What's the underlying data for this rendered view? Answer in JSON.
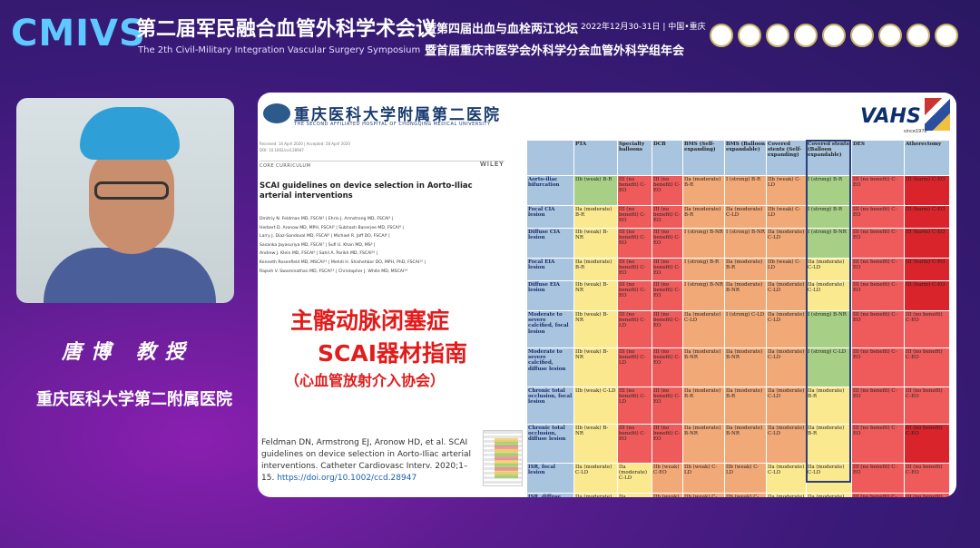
{
  "header": {
    "logo": "CMIVS",
    "title": "第二届军民融合血管外科学术会议",
    "subtitle": "The 2th Civil-Military Integration Vascular Surgery Symposium",
    "forum1": "暨第四届出血与血栓两江论坛",
    "date": "2022年12月30-31日 | 中国•重庆",
    "forum2": "暨首届重庆市医学会外科学分会血管外科学组年会"
  },
  "speaker": {
    "name": "唐博 教授",
    "affiliation": "重庆医科大学第二附属医院"
  },
  "slide": {
    "hospital_name": "重庆医科大学附属第二医院",
    "hospital_en": "THE SECOND AFFILIATED HOSPITAL OF CHONGQING MEDICAL UNIVERSITY",
    "vahs": "VAHS",
    "vahs_sub": "since1978",
    "paper": {
      "received": "Received: 14 April 2020 | Accepted: 28 April 2020",
      "doi_small": "DOI: 10.1002/ccd.28947",
      "curriculum": "CORE CURRICULUM",
      "publisher": "WILEY",
      "title": "SCAI guidelines on device selection in Aorto-Iliac arterial interventions",
      "authors": [
        "Dmitriy N. Feldman MD, FSCAI¹ | Ehrin J. Armstrong MD, FSCAI² |",
        "Herbert D. Aronow MD, MPH, FSCAI³ | Subhash Banerjee MD, FSCAI⁴ |",
        "Larry J. Diaz-Sandoval MD, FSCAI⁵ | Michael R. Jaff DO, FSCAI⁶ |",
        "Sasanka Jayasuriya MD, FSCAI⁷ | Sufi U. Khan MD, MS⁸ |",
        "Andrew J. Klein MD, FSCAI⁹ | Sahil A. Parikh MD, FSCAI¹⁰ |",
        "Kenneth Rosenfield MD, MSCAI¹¹ | Mehdi H. Shishehbor DO, MPH, PhD, FSCAI¹² |",
        "Rajesh V. Swaminathan MD, FSCAI¹³ | Christopher J. White MD, MSCAI¹⁴"
      ]
    },
    "cn_title_line1": "主髂动脉闭塞症",
    "cn_title_line2": "SCAI器材指南",
    "cn_title_line3": "（心血管放射介入协会）",
    "citation": "Feldman DN, Armstrong EJ, Aronow HD, et al. SCAI guidelines on device selection in Aorto-Iliac arterial interventions. Catheter Cardiovasc Interv. 2020;1–15.",
    "citation_doi": "https://doi.org/10.1002/ccd.28947",
    "table": {
      "headers": [
        "",
        "PTA",
        "Specialty balloons",
        "DCB",
        "BMS (Self-expanding)",
        "BMS (Balloon expandable)",
        "Covered stents (Self-expanding)",
        "Covered stents (Balloon expandable)",
        "DES",
        "Atherectomy"
      ],
      "rows": [
        {
          "label": "Aorto-iliac bifurcation",
          "h": "h2",
          "cells": [
            [
              "IIb (weak) B-R",
              "g"
            ],
            [
              "III (no benefit) C-EO",
              "r"
            ],
            [
              "III (no benefit) C-EO",
              "r"
            ],
            [
              "IIa (moderate) B-R",
              "o"
            ],
            [
              "I (strong) B-R",
              "o"
            ],
            [
              "IIb (weak) C-LD",
              "o"
            ],
            [
              "I (strong) B-R",
              "g"
            ],
            [
              "III (no benefit) C-EO",
              "r"
            ],
            [
              "III (harm) C-EO",
              "dr"
            ]
          ]
        },
        {
          "label": "Focal CIA lesion",
          "h": "h1",
          "cells": [
            [
              "IIa (moderate) B-R",
              "y"
            ],
            [
              "III (no benefit) C-EO",
              "r"
            ],
            [
              "III (no benefit) C-EO",
              "r"
            ],
            [
              "IIa (moderate) B-R",
              "o"
            ],
            [
              "IIa (moderate) C-LD",
              "o"
            ],
            [
              "IIb (weak) C-LD",
              "o"
            ],
            [
              "I (strong) B-R",
              "g"
            ],
            [
              "III (no benefit) C-EO",
              "r"
            ],
            [
              "III (harm) C-EO",
              "dr"
            ]
          ]
        },
        {
          "label": "Diffuse CIA lesion",
          "h": "h2",
          "cells": [
            [
              "IIb (weak) B-NR",
              "y"
            ],
            [
              "III (no benefit) C-EO",
              "r"
            ],
            [
              "III (no benefit) C-EO",
              "r"
            ],
            [
              "I (strong) B-NR",
              "o"
            ],
            [
              "I (strong) B-NR",
              "o"
            ],
            [
              "IIa (moderate) C-LD",
              "o"
            ],
            [
              "I (strong) B-NR",
              "g"
            ],
            [
              "III (no benefit) C-EO",
              "r"
            ],
            [
              "III (harm) C-EO",
              "dr"
            ]
          ]
        },
        {
          "label": "Focal EIA lesion",
          "h": "h1",
          "cells": [
            [
              "IIa (moderate) B-R",
              "y"
            ],
            [
              "III (no benefit) C-EO",
              "r"
            ],
            [
              "III (no benefit) C-EO",
              "r"
            ],
            [
              "I (strong) B-R",
              "o"
            ],
            [
              "IIa (moderate) B-R",
              "o"
            ],
            [
              "IIb (weak) C-LD",
              "o"
            ],
            [
              "IIa (moderate) C-LD",
              "y"
            ],
            [
              "III (no benefit) C-EO",
              "r"
            ],
            [
              "III (harm) C-EO",
              "dr"
            ]
          ]
        },
        {
          "label": "Diffuse EIA lesion",
          "h": "h2",
          "cells": [
            [
              "IIb (weak) B-NR",
              "y"
            ],
            [
              "III (no benefit) C-EO",
              "r"
            ],
            [
              "III (no benefit) C-EO",
              "r"
            ],
            [
              "I (strong) B-NR",
              "o"
            ],
            [
              "IIa (moderate) B-NR",
              "o"
            ],
            [
              "IIa (moderate) C-LD",
              "o"
            ],
            [
              "IIa (moderate) C-LD",
              "y"
            ],
            [
              "III (no benefit) C-EO",
              "r"
            ],
            [
              "III (harm) C-EO",
              "dr"
            ]
          ]
        },
        {
          "label": "Moderate to severe calcified, focal lesion",
          "h": "h3",
          "cells": [
            [
              "IIb (weak) B-NR",
              "y"
            ],
            [
              "III (no benefit) C-LD",
              "r"
            ],
            [
              "III (no benefit) C-EO",
              "r"
            ],
            [
              "IIa (moderate) C-LD",
              "o"
            ],
            [
              "I (strong) C-LD",
              "o"
            ],
            [
              "IIa (moderate) C-LD",
              "o"
            ],
            [
              "I (strong) B-NR",
              "g"
            ],
            [
              "III (no benefit) C-EO",
              "r"
            ],
            [
              "III (no benefit) C-EO",
              "r"
            ]
          ]
        },
        {
          "label": "Moderate to severe calcified, diffuse lesion",
          "h": "h4",
          "cells": [
            [
              "IIb (weak) B-NR",
              "y"
            ],
            [
              "III (no benefit) C-LD",
              "r"
            ],
            [
              "III (no benefit) C-EO",
              "r"
            ],
            [
              "IIa (moderate) B-NR",
              "o"
            ],
            [
              "IIa (moderate) B-NR",
              "o"
            ],
            [
              "IIa (moderate) C-LD",
              "o"
            ],
            [
              "I (strong) C-LD",
              "g"
            ],
            [
              "III (no benefit) C-EO",
              "r"
            ],
            [
              "III (no benefit) C-EO",
              "r"
            ]
          ]
        },
        {
          "label": "Chronic total occlusion, focal lesion",
          "h": "h3",
          "cells": [
            [
              "IIb (weak) C-LD",
              "y"
            ],
            [
              "III (no benefit) C-LD",
              "r"
            ],
            [
              "III (no benefit) C-EO",
              "r"
            ],
            [
              "IIa (moderate) B-R",
              "o"
            ],
            [
              "IIa (moderate) B-R",
              "o"
            ],
            [
              "IIa (moderate) C-LD",
              "o"
            ],
            [
              "IIa (moderate) B-R",
              "y"
            ],
            [
              "III (no benefit) C-EO",
              "r"
            ],
            [
              "III (no benefit) C-EO",
              "r"
            ]
          ]
        },
        {
          "label": "Chronic total occlusion, diffuse lesion",
          "h": "h4",
          "cells": [
            [
              "IIb (weak) B-NR",
              "y"
            ],
            [
              "III (no benefit) C-EO",
              "r"
            ],
            [
              "III (no benefit) C-EO",
              "r"
            ],
            [
              "IIa (moderate) B-NR",
              "o"
            ],
            [
              "IIa (moderate) B-NR",
              "o"
            ],
            [
              "IIa (moderate) C-LD",
              "o"
            ],
            [
              "IIa (moderate) B-R",
              "y"
            ],
            [
              "III (no benefit) C-EO",
              "r"
            ],
            [
              "III (no benefit) C-EO",
              "dr"
            ]
          ]
        },
        {
          "label": "ISR, focal lesion",
          "h": "h2",
          "cells": [
            [
              "IIa (moderate) C-LD",
              "y"
            ],
            [
              "IIa (moderate) C-LD",
              "y"
            ],
            [
              "IIb (weak) C-EO",
              "o"
            ],
            [
              "IIb (weak) C-LD",
              "o"
            ],
            [
              "IIb (weak) C-LD",
              "o"
            ],
            [
              "IIa (moderate) C-LD",
              "y"
            ],
            [
              "IIa (moderate) C-LD",
              "y"
            ],
            [
              "III (no benefit) C-EO",
              "r"
            ],
            [
              "III (no benefit) C-EO",
              "r"
            ]
          ]
        },
        {
          "label": "ISR, diffuse lesion",
          "h": "h2",
          "cells": [
            [
              "IIa (moderate) C-LD",
              "y"
            ],
            [
              "IIa (moderate) C-LD",
              "y"
            ],
            [
              "IIb (weak) C-EO",
              "o"
            ],
            [
              "IIb (weak) C-LD",
              "o"
            ],
            [
              "IIb (weak) C-LD",
              "o"
            ],
            [
              "IIa (moderate) C-LD",
              "y"
            ],
            [
              "IIa (moderate) C-LD",
              "y"
            ],
            [
              "III (no benefit) C-EO",
              "r"
            ],
            [
              "III (no benefit) C-EO",
              "r"
            ]
          ]
        }
      ]
    }
  }
}
